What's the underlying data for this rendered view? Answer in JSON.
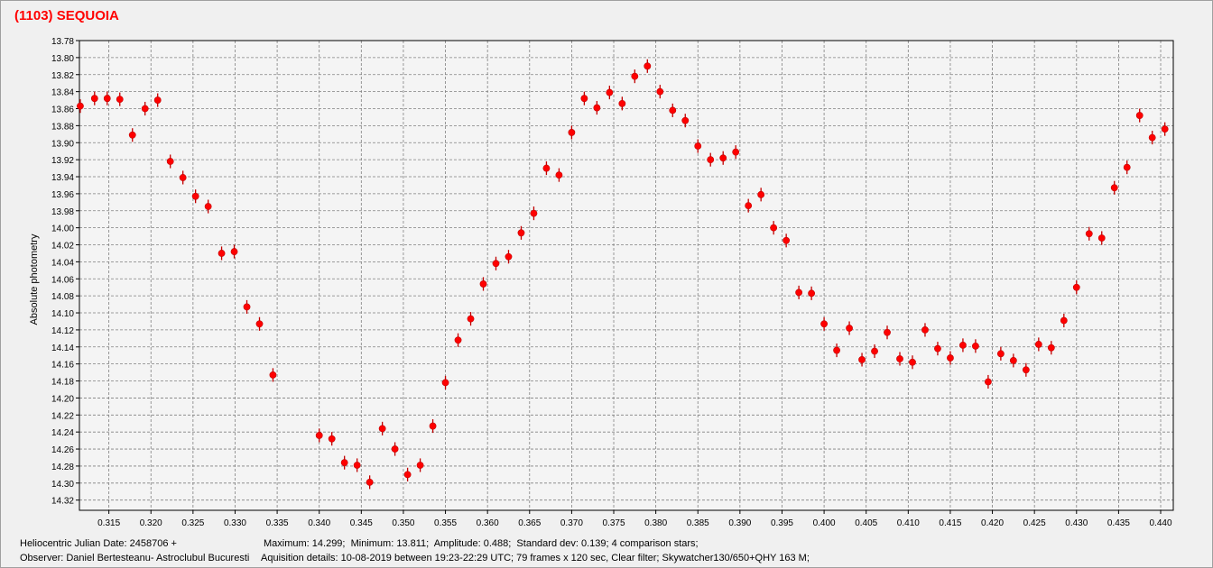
{
  "window": {
    "title": "(1103) SEQUOIA"
  },
  "colors": {
    "marker": "#ff0000",
    "errorbar": "#c00000",
    "grid": "#808080",
    "plot_bg": "#f4f4f4",
    "title": "#ff0000"
  },
  "info": {
    "line1_left": "Heliocentric Julian Date: 2458706 +",
    "line1_right": "Maximum: 14.299;  Minimum: 13.811;  Amplitude: 0.488;  Standard dev: 0.139; 4 comparison stars;",
    "line2_left": "Observer: Daniel Bertesteanu- Astroclubul Bucuresti",
    "line2_right": "Aquisition details: 10-08-2019 between 19:23-22:29 UTC; 79 frames x 120 sec, Clear filter; Skywatcher130/650+QHY 163 M;"
  },
  "chart_data": {
    "type": "scatter",
    "title": "(1103) SEQUOIA",
    "xlabel": "",
    "ylabel": "Absolute photometry",
    "xlim": [
      0.3115,
      0.4415
    ],
    "ylim": [
      13.78,
      14.332
    ],
    "y_inverted": true,
    "grid": true,
    "x_ticks": [
      "0.315",
      "0.320",
      "0.325",
      "0.330",
      "0.335",
      "0.340",
      "0.345",
      "0.350",
      "0.355",
      "0.360",
      "0.365",
      "0.370",
      "0.375",
      "0.380",
      "0.385",
      "0.390",
      "0.395",
      "0.400",
      "0.405",
      "0.410",
      "0.415",
      "0.420",
      "0.425",
      "0.430",
      "0.435",
      "0.440"
    ],
    "y_ticks": [
      "13.78",
      "13.80",
      "13.82",
      "13.84",
      "13.86",
      "13.88",
      "13.90",
      "13.92",
      "13.94",
      "13.96",
      "13.98",
      "14.00",
      "14.02",
      "14.04",
      "14.06",
      "14.08",
      "14.10",
      "14.12",
      "14.14",
      "14.16",
      "14.18",
      "14.20",
      "14.22",
      "14.24",
      "14.26",
      "14.28",
      "14.30",
      "14.32"
    ],
    "error": 0.008,
    "series": [
      {
        "x": [
          0.3116,
          0.3133,
          0.3148,
          0.3163,
          0.3178,
          0.3193,
          0.3208,
          0.3223,
          0.3238,
          0.3253,
          0.3268,
          0.3284,
          0.3299,
          0.3314,
          0.3329,
          0.3345,
          0.34,
          0.3415,
          0.343,
          0.3445,
          0.346,
          0.3475,
          0.349,
          0.3505,
          0.352,
          0.3535,
          0.355,
          0.3565,
          0.358,
          0.3595,
          0.361,
          0.3625,
          0.364,
          0.3655,
          0.367,
          0.3685,
          0.37,
          0.3715,
          0.373,
          0.3745,
          0.376,
          0.3775,
          0.379,
          0.3805,
          0.382,
          0.3835,
          0.385,
          0.3865,
          0.388,
          0.3895,
          0.391,
          0.3925,
          0.394,
          0.3955,
          0.397,
          0.3985,
          0.4,
          0.4015,
          0.403,
          0.4045,
          0.406,
          0.4075,
          0.409,
          0.4105,
          0.412,
          0.4135,
          0.415,
          0.4165,
          0.418,
          0.4195,
          0.421,
          0.4225,
          0.424,
          0.4255,
          0.427,
          0.4285,
          0.43,
          0.4315,
          0.433,
          0.4345,
          0.436,
          0.4375,
          0.439,
          0.4405
        ],
        "y": [
          13.857,
          13.848,
          13.848,
          13.849,
          13.891,
          13.86,
          13.85,
          13.922,
          13.941,
          13.963,
          13.975,
          14.03,
          14.028,
          14.093,
          14.113,
          14.173,
          14.244,
          14.248,
          14.276,
          14.279,
          14.299,
          14.236,
          14.26,
          14.29,
          14.279,
          14.233,
          14.182,
          14.132,
          14.107,
          14.066,
          14.042,
          14.034,
          14.006,
          13.983,
          13.93,
          13.938,
          13.888,
          13.848,
          13.859,
          13.841,
          13.854,
          13.822,
          13.81,
          13.84,
          13.862,
          13.874,
          13.904,
          13.92,
          13.918,
          13.911,
          13.974,
          13.961,
          14.0,
          14.015,
          14.076,
          14.077,
          14.113,
          14.144,
          14.118,
          14.155,
          14.145,
          14.123,
          14.154,
          14.158,
          14.12,
          14.142,
          14.153,
          14.138,
          14.139,
          14.181,
          14.148,
          14.156,
          14.167,
          14.137,
          14.141,
          14.109,
          14.07,
          14.007,
          14.012,
          13.953,
          13.929,
          13.868,
          13.894,
          13.884
        ]
      }
    ]
  }
}
